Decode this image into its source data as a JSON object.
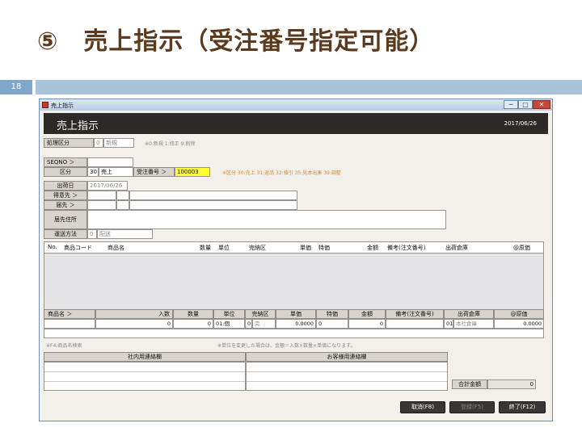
{
  "slide": {
    "title": "⑤　売上指示（受注番号指定可能）",
    "page_number": "18"
  },
  "window": {
    "title": "売上指示",
    "controls": [
      "─",
      "□",
      "✕"
    ]
  },
  "header": {
    "title": "売上指示",
    "date": "2017/06/26"
  },
  "form": {
    "shori_kubun": {
      "label": "処理区分",
      "code": "0",
      "value": "新規",
      "hint": "※0:新規 1:修正 9:削除"
    },
    "seqno": {
      "label": "SEQNO ＞",
      "value": ""
    },
    "kubun": {
      "label": "区分",
      "code": "30",
      "value": "売上"
    },
    "juchu_bango": {
      "label": "受注番号 ＞",
      "value": "100003"
    },
    "kubun_hint": "※区分 30:売上 31:返品 32:値引 35:見本出庫 39:調整",
    "shukka_bi": {
      "label": "出荷日",
      "value": "2017/06/26"
    },
    "tokuisaki": {
      "label": "得意先 ＞"
    },
    "todokesaki": {
      "label": "届先 ＞"
    },
    "todoke_jusho": {
      "label": "届先住所"
    },
    "unso_hoho": {
      "label": "運送方法",
      "code": "0",
      "value": "配送"
    }
  },
  "grid": {
    "columns": [
      "No.",
      "商品コード",
      "商品名",
      "数量",
      "単位",
      "完納区",
      "単価",
      "特価",
      "金額",
      "備考(注文番号)",
      "出荷倉庫",
      "@原価"
    ]
  },
  "detail": {
    "headers": [
      "商品名 ＞",
      "入数",
      "数量",
      "単位",
      "完納区",
      "単価",
      "特価",
      "金額",
      "備考(注文番号)",
      "出荷倉庫",
      "@原価"
    ],
    "irisu": "0",
    "suryo": "0",
    "tani": "01:個",
    "kanno_code": "0",
    "kanno_value": "完",
    "tanka": "0.0000",
    "tokka_code": "0",
    "kingaku": "0",
    "soko_code": "01",
    "soko_value": "本社倉庫",
    "genka": "0.0000",
    "hint_left": "※F4:商品名検索",
    "hint_right": "※単位を変更した場合は、金額＝入数×数量×単価になります。"
  },
  "contacts": {
    "internal_label": "社内用連絡欄",
    "customer_label": "お客様用連絡欄"
  },
  "total": {
    "label": "合計金額",
    "value": "0"
  },
  "buttons": {
    "cancel": "取消(F8)",
    "register": "登録(F5)",
    "exit": "終了(F12)"
  },
  "colors": {
    "header_bg": "#2d2926",
    "highlight_field": "#ffff33",
    "hint_orange": "#d88b2a",
    "slide_title": "#5c3a1e"
  }
}
